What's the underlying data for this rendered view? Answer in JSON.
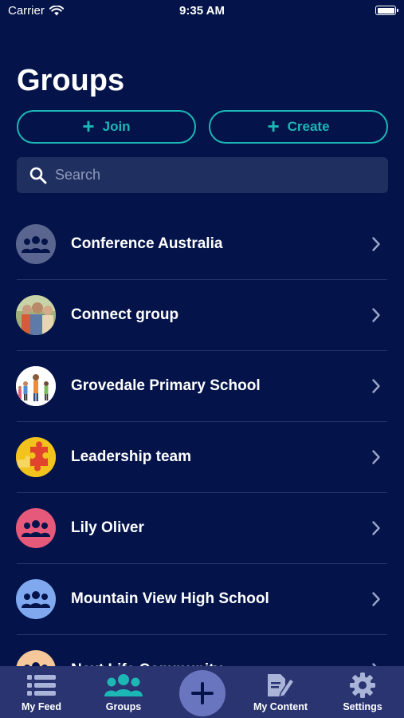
{
  "status_bar": {
    "carrier": "Carrier",
    "time": "9:35 AM"
  },
  "page": {
    "title": "Groups"
  },
  "actions": {
    "join_label": "Join",
    "create_label": "Create"
  },
  "search": {
    "placeholder": "Search"
  },
  "groups": [
    {
      "name": "Conference Australia",
      "avatar": "group-icon",
      "avatar_color": "#5b6690"
    },
    {
      "name": "Connect group",
      "avatar": "photo",
      "avatar_color": "#6b8a6a"
    },
    {
      "name": "Grovedale Primary School",
      "avatar": "photo",
      "avatar_color": "#ffffff"
    },
    {
      "name": "Leadership team",
      "avatar": "puzzle-photo",
      "avatar_color": "#f2c21d"
    },
    {
      "name": "Lily Oliver",
      "avatar": "group-icon",
      "avatar_color": "#e7597b"
    },
    {
      "name": "Mountain View High School",
      "avatar": "group-icon",
      "avatar_color": "#7fa8ef"
    },
    {
      "name": "Next Life Community",
      "avatar": "group-icon",
      "avatar_color": "#f6c79b"
    }
  ],
  "tabs": [
    {
      "label": "My Feed",
      "icon": "list-icon"
    },
    {
      "label": "Groups",
      "icon": "group-icon",
      "active": true
    },
    {
      "label": "",
      "icon": "plus-icon"
    },
    {
      "label": "My Content",
      "icon": "edit-document-icon"
    },
    {
      "label": "Settings",
      "icon": "gear-icon"
    }
  ],
  "colors": {
    "background": "#04144a",
    "accent": "#1cb7b5",
    "tab_bar": "#2a3471",
    "inactive_icon": "#aab4d8"
  }
}
